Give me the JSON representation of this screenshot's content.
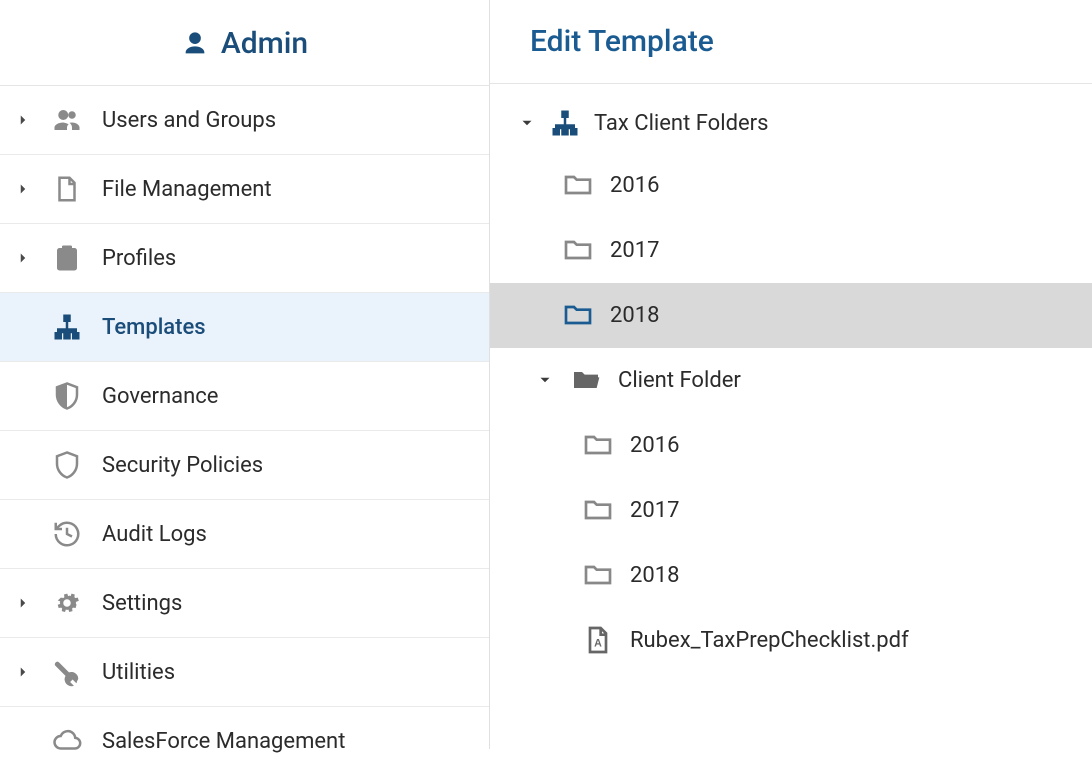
{
  "sidebar": {
    "title": "Admin",
    "items": [
      {
        "label": "Users and Groups",
        "icon": "users",
        "expandable": true
      },
      {
        "label": "File Management",
        "icon": "file",
        "expandable": true
      },
      {
        "label": "Profiles",
        "icon": "clipboard",
        "expandable": true
      },
      {
        "label": "Templates",
        "icon": "hierarchy",
        "expandable": false,
        "selected": true
      },
      {
        "label": "Governance",
        "icon": "shield-half",
        "expandable": false
      },
      {
        "label": "Security Policies",
        "icon": "shield",
        "expandable": false
      },
      {
        "label": "Audit Logs",
        "icon": "history",
        "expandable": false
      },
      {
        "label": "Settings",
        "icon": "gear",
        "expandable": true
      },
      {
        "label": "Utilities",
        "icon": "wrench",
        "expandable": true
      },
      {
        "label": "SalesForce Management",
        "icon": "cloud",
        "expandable": false
      }
    ]
  },
  "main": {
    "title": "Edit Template",
    "tree": {
      "root": {
        "label": "Tax Client Folders",
        "expanded": true,
        "children": [
          {
            "label": "2016",
            "type": "folder"
          },
          {
            "label": "2017",
            "type": "folder"
          },
          {
            "label": "2018",
            "type": "folder",
            "selected": true
          },
          {
            "label": "Client Folder",
            "type": "folder-open",
            "expanded": true,
            "children": [
              {
                "label": "2016",
                "type": "folder"
              },
              {
                "label": "2017",
                "type": "folder"
              },
              {
                "label": "2018",
                "type": "folder"
              },
              {
                "label": "Rubex_TaxPrepChecklist.pdf",
                "type": "pdf"
              }
            ]
          }
        ]
      }
    }
  },
  "colors": {
    "accent": "#1a4d7a",
    "selectedBg": "#eaf2fb",
    "rowSelectedBg": "#d9d9d9"
  }
}
